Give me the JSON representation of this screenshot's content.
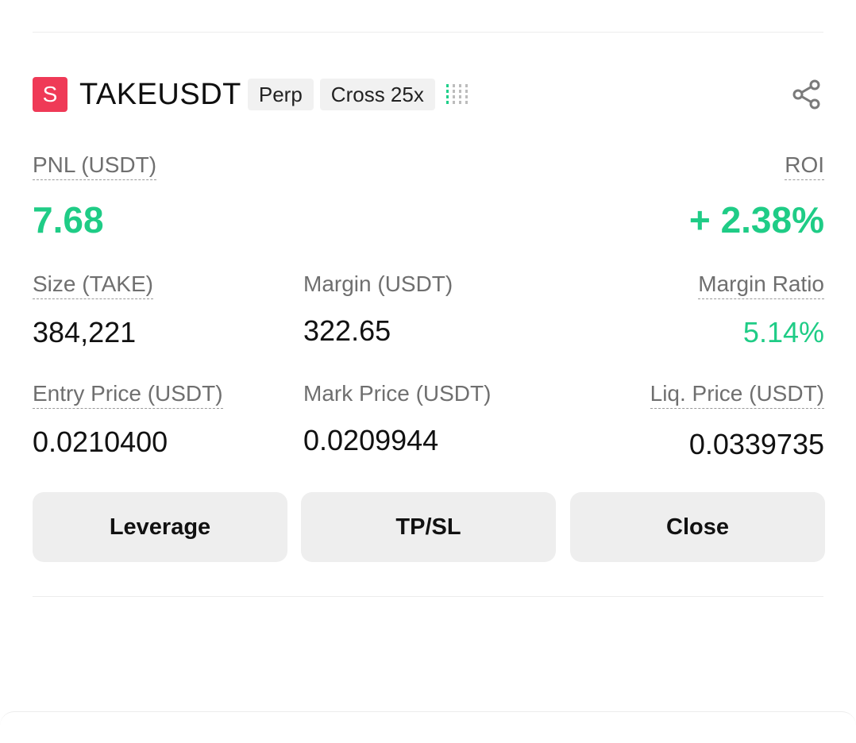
{
  "position": {
    "coin_badge": "S",
    "symbol": "TAKEUSDT",
    "type_tag": "Perp",
    "margin_tag": "Cross 25x",
    "signal_level": 1,
    "signal_bars": 4
  },
  "pnl": {
    "label": "PNL (USDT)",
    "value": "7.68"
  },
  "roi": {
    "label": "ROI",
    "value": "+ 2.38%"
  },
  "size": {
    "label": "Size (TAKE)",
    "value": "384,221"
  },
  "margin": {
    "label": "Margin (USDT)",
    "value": "322.65"
  },
  "margin_ratio": {
    "label": "Margin Ratio",
    "value": "5.14%"
  },
  "entry_price": {
    "label": "Entry Price (USDT)",
    "value": "0.0210400"
  },
  "mark_price": {
    "label": "Mark Price (USDT)",
    "value": "0.0209944"
  },
  "liq_price": {
    "label": "Liq. Price (USDT)",
    "value": "0.0339735"
  },
  "actions": {
    "leverage": "Leverage",
    "tpsl": "TP/SL",
    "close": "Close"
  },
  "icons": {
    "share": "share-icon"
  },
  "colors": {
    "profit": "#1fcc86",
    "badge": "#ef3a57"
  }
}
